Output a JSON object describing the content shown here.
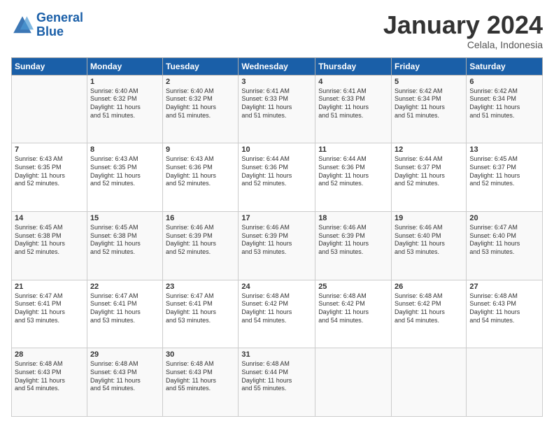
{
  "logo": {
    "line1": "General",
    "line2": "Blue"
  },
  "title": "January 2024",
  "subtitle": "Celala, Indonesia",
  "headers": [
    "Sunday",
    "Monday",
    "Tuesday",
    "Wednesday",
    "Thursday",
    "Friday",
    "Saturday"
  ],
  "weeks": [
    [
      {
        "day": "",
        "info": ""
      },
      {
        "day": "1",
        "info": "Sunrise: 6:40 AM\nSunset: 6:32 PM\nDaylight: 11 hours\nand 51 minutes."
      },
      {
        "day": "2",
        "info": "Sunrise: 6:40 AM\nSunset: 6:32 PM\nDaylight: 11 hours\nand 51 minutes."
      },
      {
        "day": "3",
        "info": "Sunrise: 6:41 AM\nSunset: 6:33 PM\nDaylight: 11 hours\nand 51 minutes."
      },
      {
        "day": "4",
        "info": "Sunrise: 6:41 AM\nSunset: 6:33 PM\nDaylight: 11 hours\nand 51 minutes."
      },
      {
        "day": "5",
        "info": "Sunrise: 6:42 AM\nSunset: 6:34 PM\nDaylight: 11 hours\nand 51 minutes."
      },
      {
        "day": "6",
        "info": "Sunrise: 6:42 AM\nSunset: 6:34 PM\nDaylight: 11 hours\nand 51 minutes."
      }
    ],
    [
      {
        "day": "7",
        "info": "Sunrise: 6:43 AM\nSunset: 6:35 PM\nDaylight: 11 hours\nand 52 minutes."
      },
      {
        "day": "8",
        "info": "Sunrise: 6:43 AM\nSunset: 6:35 PM\nDaylight: 11 hours\nand 52 minutes."
      },
      {
        "day": "9",
        "info": "Sunrise: 6:43 AM\nSunset: 6:36 PM\nDaylight: 11 hours\nand 52 minutes."
      },
      {
        "day": "10",
        "info": "Sunrise: 6:44 AM\nSunset: 6:36 PM\nDaylight: 11 hours\nand 52 minutes."
      },
      {
        "day": "11",
        "info": "Sunrise: 6:44 AM\nSunset: 6:36 PM\nDaylight: 11 hours\nand 52 minutes."
      },
      {
        "day": "12",
        "info": "Sunrise: 6:44 AM\nSunset: 6:37 PM\nDaylight: 11 hours\nand 52 minutes."
      },
      {
        "day": "13",
        "info": "Sunrise: 6:45 AM\nSunset: 6:37 PM\nDaylight: 11 hours\nand 52 minutes."
      }
    ],
    [
      {
        "day": "14",
        "info": "Sunrise: 6:45 AM\nSunset: 6:38 PM\nDaylight: 11 hours\nand 52 minutes."
      },
      {
        "day": "15",
        "info": "Sunrise: 6:45 AM\nSunset: 6:38 PM\nDaylight: 11 hours\nand 52 minutes."
      },
      {
        "day": "16",
        "info": "Sunrise: 6:46 AM\nSunset: 6:39 PM\nDaylight: 11 hours\nand 52 minutes."
      },
      {
        "day": "17",
        "info": "Sunrise: 6:46 AM\nSunset: 6:39 PM\nDaylight: 11 hours\nand 53 minutes."
      },
      {
        "day": "18",
        "info": "Sunrise: 6:46 AM\nSunset: 6:39 PM\nDaylight: 11 hours\nand 53 minutes."
      },
      {
        "day": "19",
        "info": "Sunrise: 6:46 AM\nSunset: 6:40 PM\nDaylight: 11 hours\nand 53 minutes."
      },
      {
        "day": "20",
        "info": "Sunrise: 6:47 AM\nSunset: 6:40 PM\nDaylight: 11 hours\nand 53 minutes."
      }
    ],
    [
      {
        "day": "21",
        "info": "Sunrise: 6:47 AM\nSunset: 6:41 PM\nDaylight: 11 hours\nand 53 minutes."
      },
      {
        "day": "22",
        "info": "Sunrise: 6:47 AM\nSunset: 6:41 PM\nDaylight: 11 hours\nand 53 minutes."
      },
      {
        "day": "23",
        "info": "Sunrise: 6:47 AM\nSunset: 6:41 PM\nDaylight: 11 hours\nand 53 minutes."
      },
      {
        "day": "24",
        "info": "Sunrise: 6:48 AM\nSunset: 6:42 PM\nDaylight: 11 hours\nand 54 minutes."
      },
      {
        "day": "25",
        "info": "Sunrise: 6:48 AM\nSunset: 6:42 PM\nDaylight: 11 hours\nand 54 minutes."
      },
      {
        "day": "26",
        "info": "Sunrise: 6:48 AM\nSunset: 6:42 PM\nDaylight: 11 hours\nand 54 minutes."
      },
      {
        "day": "27",
        "info": "Sunrise: 6:48 AM\nSunset: 6:43 PM\nDaylight: 11 hours\nand 54 minutes."
      }
    ],
    [
      {
        "day": "28",
        "info": "Sunrise: 6:48 AM\nSunset: 6:43 PM\nDaylight: 11 hours\nand 54 minutes."
      },
      {
        "day": "29",
        "info": "Sunrise: 6:48 AM\nSunset: 6:43 PM\nDaylight: 11 hours\nand 54 minutes."
      },
      {
        "day": "30",
        "info": "Sunrise: 6:48 AM\nSunset: 6:43 PM\nDaylight: 11 hours\nand 55 minutes."
      },
      {
        "day": "31",
        "info": "Sunrise: 6:48 AM\nSunset: 6:44 PM\nDaylight: 11 hours\nand 55 minutes."
      },
      {
        "day": "",
        "info": ""
      },
      {
        "day": "",
        "info": ""
      },
      {
        "day": "",
        "info": ""
      }
    ]
  ]
}
